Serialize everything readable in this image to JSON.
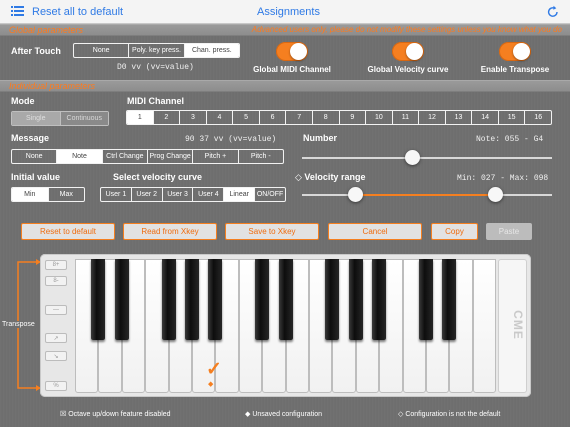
{
  "header": {
    "reset_all_label": "Reset all to default",
    "title": "Assignments"
  },
  "global": {
    "section_label": "Global parameters",
    "warning": "Advanced users only, please do not modify these settings unless you know what you do",
    "after_touch_label": "After Touch",
    "after_touch_options": [
      "None",
      "Poly. key press.",
      "Chan. press."
    ],
    "after_touch_selected": "Chan. press.",
    "after_touch_code": "D0 vv (vv=value)",
    "toggles": [
      {
        "label": "Global MIDI Channel",
        "on": true
      },
      {
        "label": "Global Velocity curve",
        "on": true
      },
      {
        "label": "Enable Transpose",
        "on": true
      }
    ]
  },
  "individual": {
    "section_label": "Individual parameters",
    "mode_label": "Mode",
    "mode_options": [
      "Single",
      "Continuous"
    ],
    "mode_selected": "Single",
    "midi_channel_label": "MIDI Channel",
    "midi_channels": [
      "1",
      "2",
      "3",
      "4",
      "5",
      "6",
      "7",
      "8",
      "9",
      "10",
      "11",
      "12",
      "13",
      "14",
      "15",
      "16"
    ],
    "midi_channel_selected": "1",
    "message_label": "Message",
    "message_code": "90 37 vv (vv=value)",
    "message_options": [
      "None",
      "Note",
      "Ctrl Change",
      "Prog Change",
      "Pitch +",
      "Pitch -"
    ],
    "message_selected": "Note",
    "number_label": "Number",
    "number_value_text": "Note: 055 - G4",
    "number_fraction": 0.44,
    "initial_value_label": "Initial value",
    "initial_value_options": [
      "Min",
      "Max"
    ],
    "initial_value_selected": "Min",
    "velocity_curve_label": "Select velocity curve",
    "velocity_curve_options": [
      "User 1",
      "User 2",
      "User 3",
      "User 4",
      "Linear",
      "ON/OFF"
    ],
    "velocity_curve_selected": "Linear",
    "velocity_range_label": "Velocity range",
    "velocity_range_text": "Min: 027 - Max: 098",
    "velocity_min": 27,
    "velocity_max": 98
  },
  "actions": [
    "Reset to default",
    "Read from Xkey",
    "Save to Xkey",
    "Cancel",
    "Copy",
    "Paste"
  ],
  "keyboard": {
    "transpose_label": "Transpose",
    "brand": "CME",
    "selected_key_mark": "✓",
    "unsaved_mark": "◆"
  },
  "legend": [
    "☒ Octave up/down feature disabled",
    "◆ Unsaved configuration",
    "◇ Configuration is not the default"
  ],
  "colors": {
    "accent": "#f57f20",
    "link": "#2f7ae5"
  }
}
